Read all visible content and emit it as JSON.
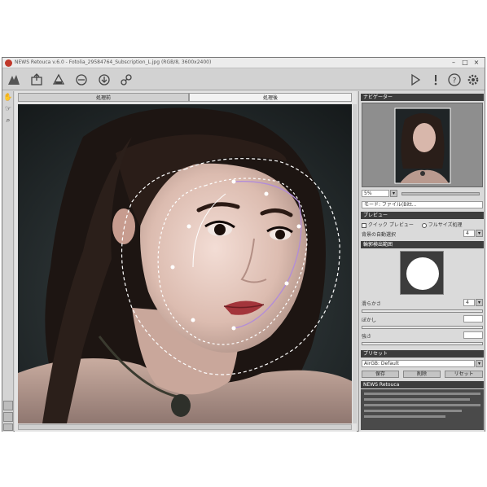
{
  "window": {
    "title": "NEWS Retouca v.6.0 - Fotolia_29584764_Subscription_L.jpg (RGB/8, 3600x2400)",
    "controls": [
      "–",
      "□",
      "×"
    ]
  },
  "toolbar": {
    "icons": [
      "hand-tool-icon",
      "open-icon",
      "save-icon",
      "undo-icon",
      "apply-icon",
      "settings-link-icon",
      "play-icon",
      "info-icon",
      "help-icon",
      "gear-icon"
    ]
  },
  "canvas": {
    "tabs": [
      "処理前",
      "処理後"
    ]
  },
  "panel": {
    "navigator": {
      "title": "ナビゲーター",
      "zoom": "5%"
    },
    "mode": {
      "label": "モード: ファイル(Bitt...",
      "value": ""
    },
    "preview": {
      "title": "プレビュー",
      "quick_preview": "クイック プレビュー",
      "full_process": "フルサイズ処理",
      "size_label": "背景の自動選択",
      "size_value": "4"
    },
    "brush": {
      "title": "輪郭検出範囲"
    },
    "sliders": [
      {
        "label": "滑らかさ",
        "value": "4"
      },
      {
        "label": "ぼかし",
        "value": ""
      },
      {
        "label": "強さ",
        "value": ""
      }
    ],
    "preset": {
      "title": "プリセット",
      "value": "AirGB: Default",
      "buttons": [
        "保存",
        "削除",
        "リセット"
      ]
    },
    "info_title": "NEWS Retouca"
  },
  "colors": {
    "accent": "#3d3d3d",
    "panel_bg": "#dadada",
    "toolbar_bg": "#d2d2d2"
  }
}
